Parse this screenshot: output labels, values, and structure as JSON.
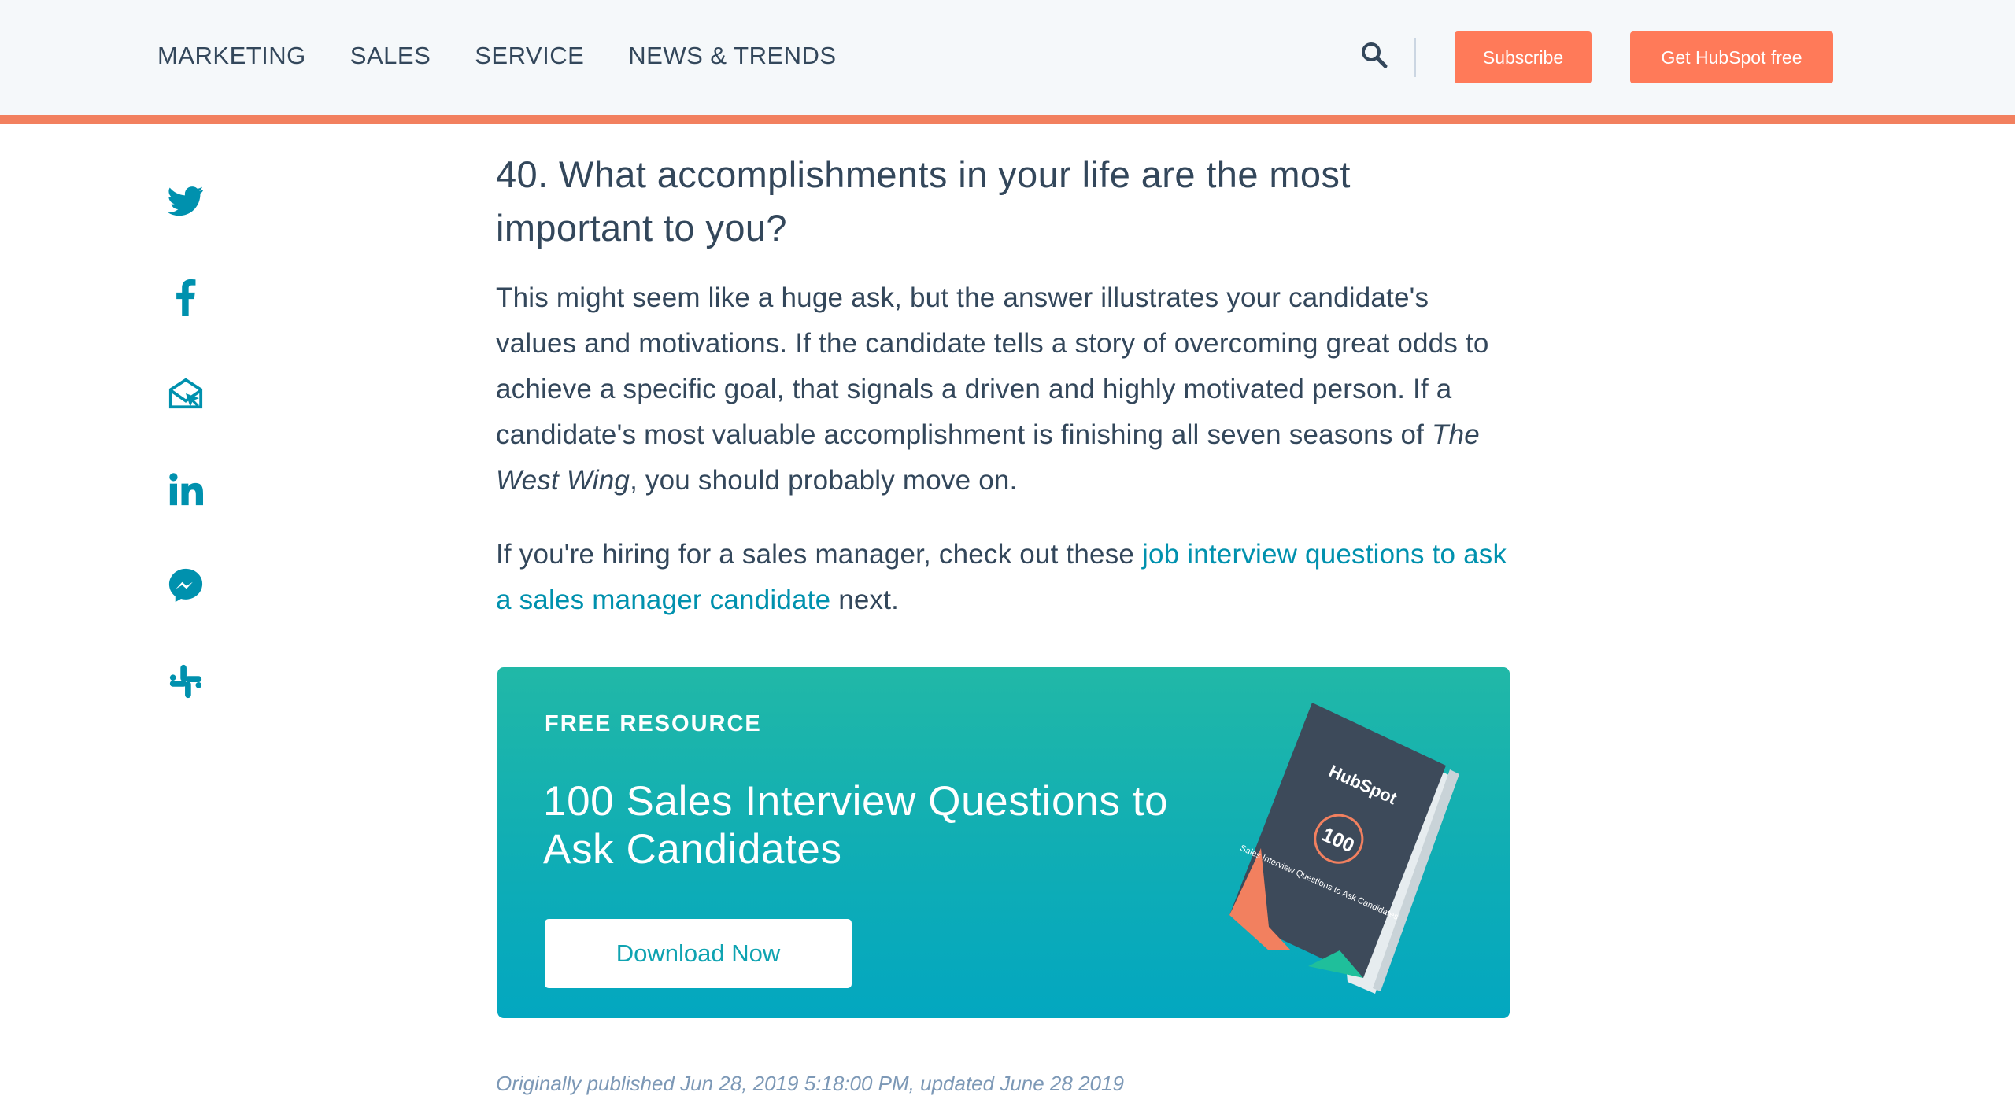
{
  "header": {
    "nav": [
      "MARKETING",
      "SALES",
      "SERVICE",
      "NEWS & TRENDS"
    ],
    "subscribe_label": "Subscribe",
    "get_free_label": "Get HubSpot free"
  },
  "share": [
    "twitter-icon",
    "facebook-icon",
    "email-icon",
    "linkedin-icon",
    "messenger-icon",
    "slack-icon"
  ],
  "article": {
    "heading": "40. What accomplishments in your life are the most important to you?",
    "para1_text": "This might seem like a huge ask, but the answer illustrates your candidate's values and motivations. If the candidate tells a story of overcoming great odds to achieve a specific goal, that signals a driven and highly motivated person. If a candidate's most valuable accomplishment is finishing all seven seasons of ",
    "para1_italic": "The West Wing",
    "para1_tail": ", you should probably move on.",
    "para2_text": "If you're hiring for a sales manager, check out these ",
    "para2_link": "job interview questions to ask a sales manager candidate",
    "para2_tail": " next."
  },
  "banner": {
    "eyebrow": "FREE RESOURCE",
    "title": "100 Sales Interview Questions to Ask Candidates",
    "cta": "Download Now",
    "book_brand": "HubSpot",
    "book_number": "100",
    "book_subtitle": "Sales Interview Questions to Ask Candidates"
  },
  "footer": {
    "published_text": "Originally published Jun 28, 2019 5:18:00 PM, updated June 28 2019"
  },
  "colors": {
    "accent": "#f2805f",
    "button": "#ff7a59",
    "link": "#0091ae",
    "text": "#33475b",
    "icon": "#0091ae"
  }
}
